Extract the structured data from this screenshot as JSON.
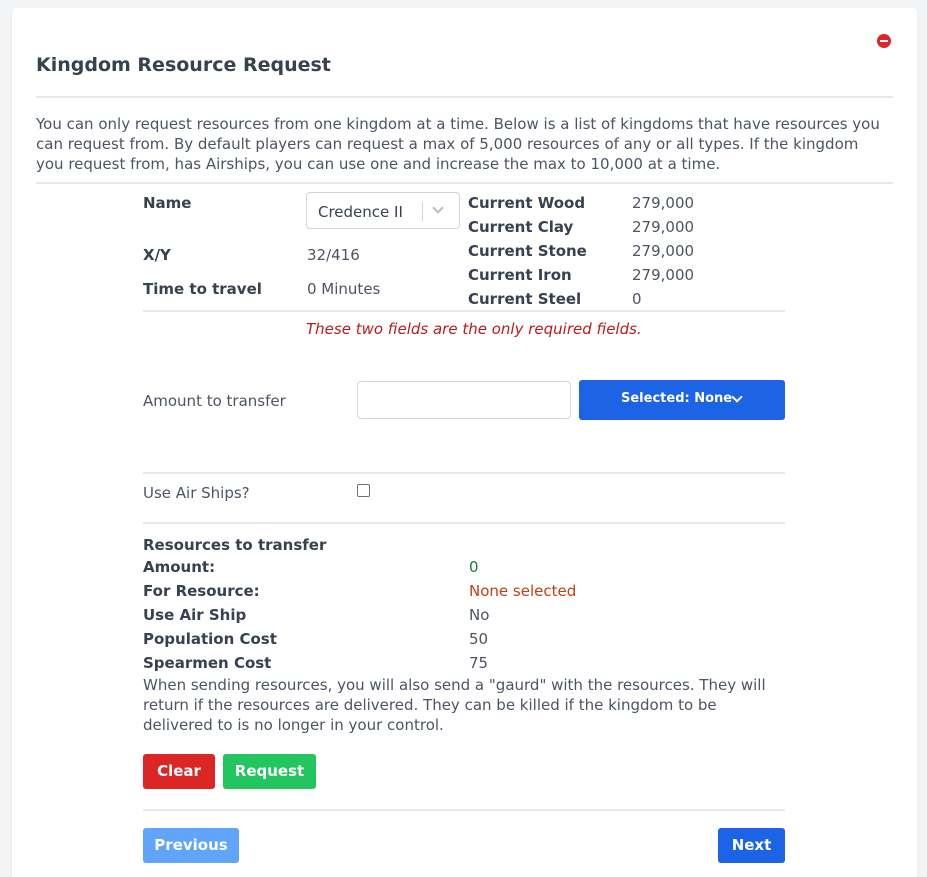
{
  "colors": {
    "primary": "#1d63e5",
    "danger": "#dc2626",
    "success": "#22c55e",
    "disabled": "#60a5fa",
    "amount_green": "#15803d",
    "warning_orange": "#c2410c",
    "note_red": "#b91c1c"
  },
  "header": {
    "title": "Kingdom Resource Request",
    "close_icon": "minus-circle-icon"
  },
  "intro": "You can only request resources from one kingdom at a time. Below is a list of kingdoms that have resources you can request from. By default players can request a max of 5,000 resources of any or all types. If the kingdom you request from, has Airships, you can use one and increase the max to 10,000 at a time.",
  "kingdom": {
    "name_label": "Name",
    "selected_kingdom": "Credence II",
    "xy_label": "X/Y",
    "xy_value": "32/416",
    "travel_label": "Time to travel",
    "travel_value": "0 Minutes"
  },
  "resources": [
    {
      "label": "Current Wood",
      "value": "279,000"
    },
    {
      "label": "Current Clay",
      "value": "279,000"
    },
    {
      "label": "Current Stone",
      "value": "279,000"
    },
    {
      "label": "Current Iron",
      "value": "279,000"
    },
    {
      "label": "Current Steel",
      "value": "0"
    }
  ],
  "form": {
    "required_note": "These two fields are the only required fields.",
    "amount_label": "Amount to transfer",
    "amount_value": "",
    "resource_dropdown": "Selected: None",
    "airship_label": "Use Air Ships?",
    "airship_checked": false
  },
  "summary": {
    "heading": "Resources to transfer",
    "amount_label": "Amount:",
    "amount_value": "0",
    "resource_label": "For Resource:",
    "resource_value": "None selected",
    "airship_label": "Use Air Ship",
    "airship_value": "No",
    "population_label": "Population Cost",
    "population_value": "50",
    "spearmen_label": "Spearmen Cost",
    "spearmen_value": "75",
    "guard_note": "When sending resources, you will also send a \"gaurd\" with the resources. They will return if the resources are delivered. They can be killed if the kingdom to be delivered to is no longer in your control."
  },
  "actions": {
    "clear": "Clear",
    "request": "Request",
    "previous": "Previous",
    "next": "Next"
  }
}
